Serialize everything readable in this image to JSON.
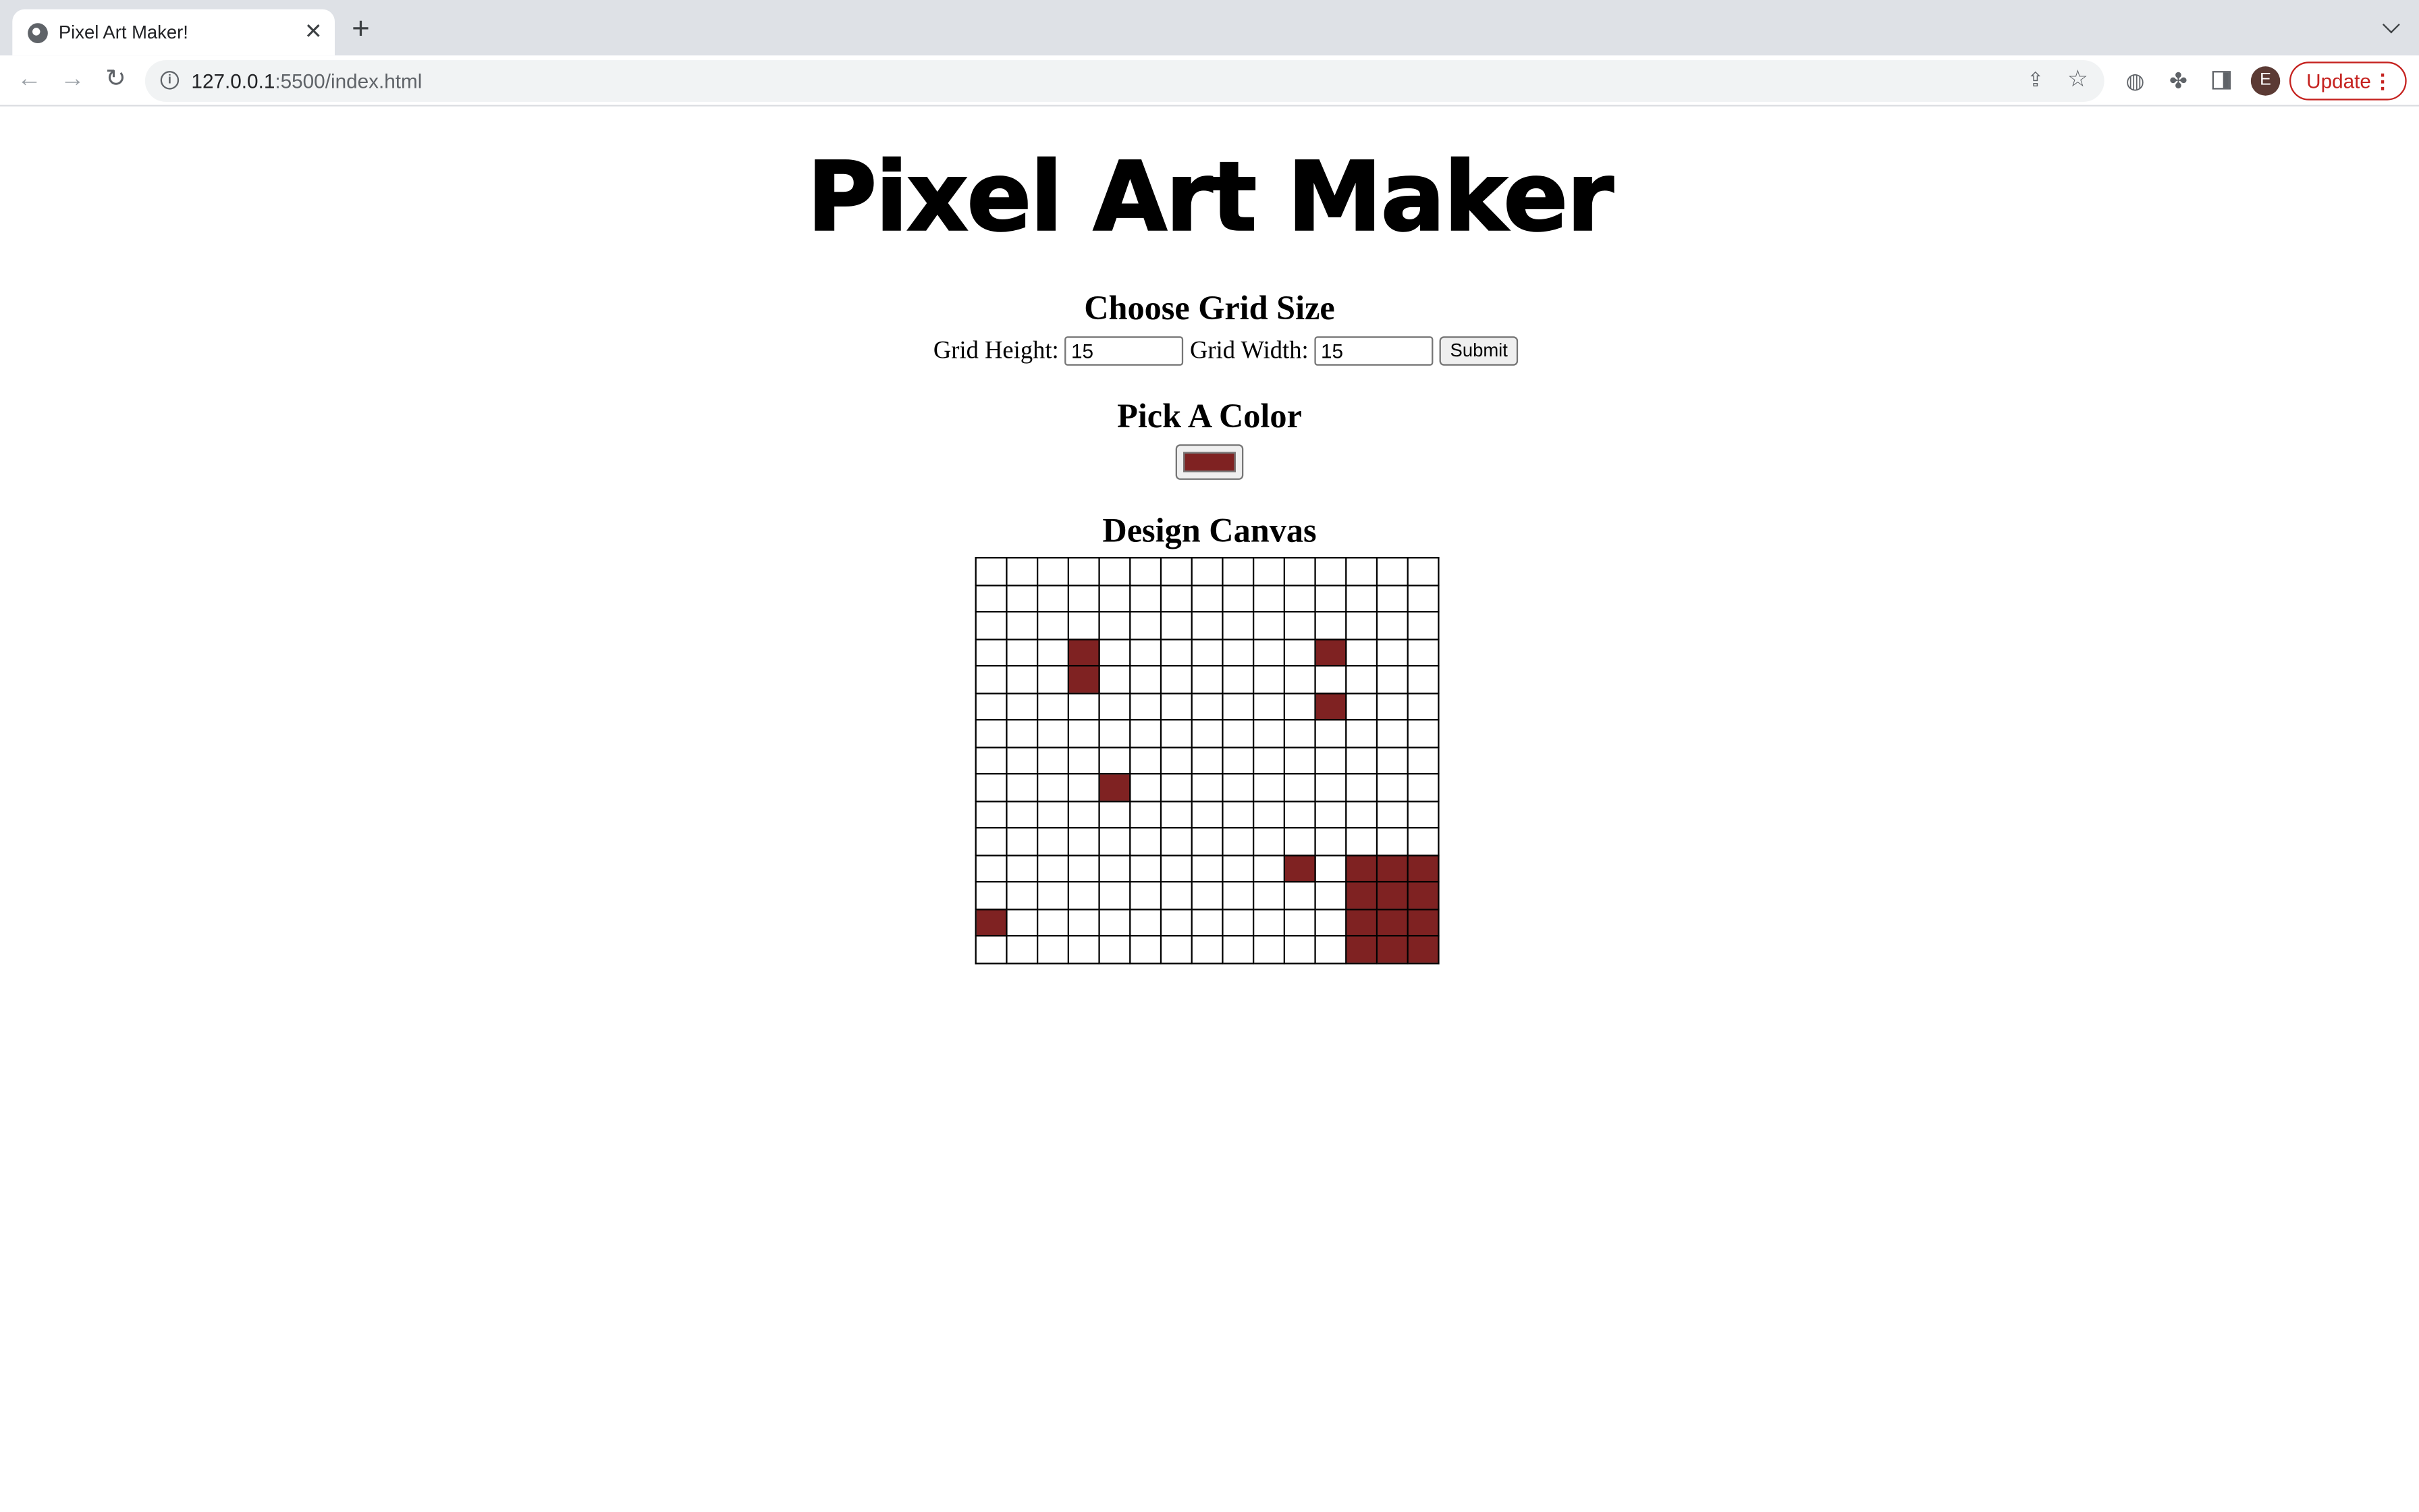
{
  "browser": {
    "tab_title": "Pixel Art Maker!",
    "url_host": "127.0.0.1",
    "url_rest": ":5500/index.html",
    "avatar_letter": "E",
    "update_label": "Update"
  },
  "page": {
    "logo_text": "Pixel Art Maker",
    "grid_heading": "Choose Grid Size",
    "height_label": "Grid Height:",
    "height_value": "15",
    "width_label": "Grid Width:",
    "width_value": "15",
    "submit_label": "Submit",
    "color_heading": "Pick A Color",
    "color_value": "#7f2222",
    "canvas_heading": "Design Canvas"
  },
  "canvas": {
    "rows": 15,
    "cols": 15,
    "filled_color": "#7f2222",
    "filled_cells": [
      [
        3,
        3
      ],
      [
        3,
        11
      ],
      [
        4,
        3
      ],
      [
        5,
        11
      ],
      [
        8,
        4
      ],
      [
        11,
        10
      ],
      [
        11,
        12
      ],
      [
        11,
        13
      ],
      [
        11,
        14
      ],
      [
        12,
        12
      ],
      [
        12,
        13
      ],
      [
        12,
        14
      ],
      [
        13,
        0
      ],
      [
        13,
        12
      ],
      [
        13,
        13
      ],
      [
        13,
        14
      ],
      [
        14,
        12
      ],
      [
        14,
        13
      ],
      [
        14,
        14
      ]
    ]
  }
}
